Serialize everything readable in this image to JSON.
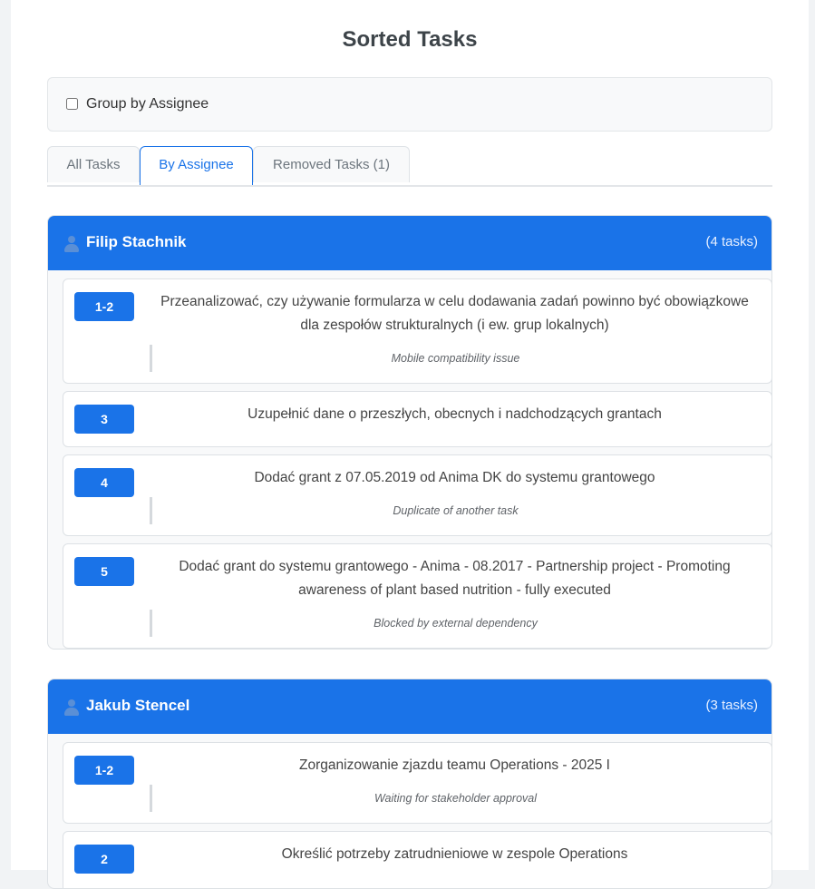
{
  "title": "Sorted Tasks",
  "group_by_label": "Group by Assignee",
  "group_by_checked": false,
  "tabs": [
    {
      "label": "All Tasks",
      "active": false
    },
    {
      "label": "By Assignee",
      "active": true
    },
    {
      "label": "Removed Tasks (1)",
      "active": false
    }
  ],
  "assignees": [
    {
      "name": "Filip Stachnik",
      "count": "(4 tasks)",
      "tasks": [
        {
          "badge": "1-2",
          "text": "Przeanalizować, czy używanie formularza w celu dodawania zadań powinno być obowiązkowe dla zespołów strukturalnych (i ew. grup lokalnych)",
          "note": "Mobile compatibility issue"
        },
        {
          "badge": "3",
          "text": "Uzupełnić dane o przeszłych, obecnych i nadchodzących grantach",
          "note": ""
        },
        {
          "badge": "4",
          "text": "Dodać grant z 07.05.2019 od Anima DK do systemu grantowego",
          "note": "Duplicate of another task"
        },
        {
          "badge": "5",
          "text": "Dodać grant do systemu grantowego - Anima - 08.2017 - Partnership project - Promoting awareness of plant based nutrition - fully executed",
          "note": "Blocked by external dependency"
        }
      ]
    },
    {
      "name": "Jakub Stencel",
      "count": "(3 tasks)",
      "tasks": [
        {
          "badge": "1-2",
          "text": "Zorganizowanie zjazdu teamu Operations - 2025 I",
          "note": "Waiting for stakeholder approval"
        },
        {
          "badge": "2",
          "text": "Określić potrzeby zatrudnieniowe w zespole Operations",
          "note": ""
        }
      ]
    }
  ]
}
